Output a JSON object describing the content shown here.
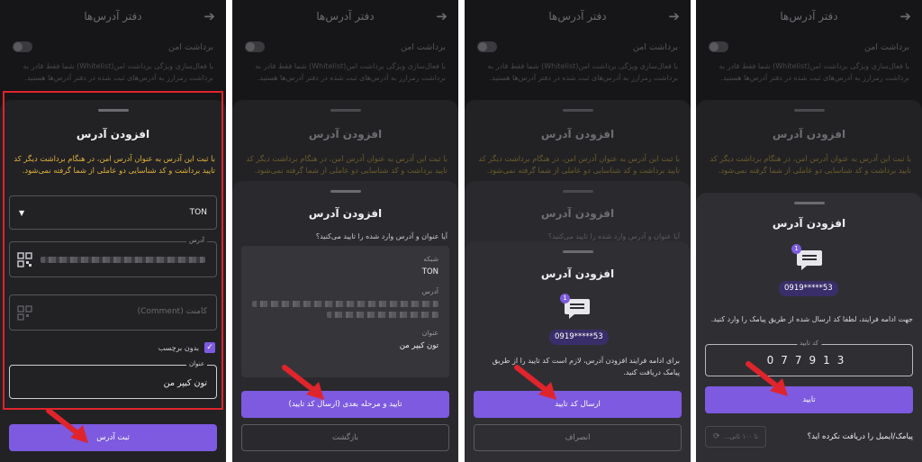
{
  "header": {
    "title": "دفتر آدرس‌ها",
    "back_icon": "arrow-right-icon"
  },
  "safe_withdraw": {
    "label": "برداشت امن",
    "description": "با فعال‌سازی ویژگی برداشت امن(Whitelist) شما فقط قادر به برداشت رمزارز به آدرس‌های ثبت شده در دفتر آدرس‌ها هستید."
  },
  "add_address": {
    "title": "افزودن آدرس",
    "warning": "با ثبت این آدرس به عنوان آدرس امن، در هنگام برداشت دیگر کد تایید برداشت و کد شناسایی دو عاملی از شما گرفته نمی‌شود.",
    "network_value": "TON",
    "address_label": "آدرس",
    "comment_placeholder": "کامنت (Comment)",
    "no_tag_label": "بدون برچسب",
    "title_label": "عنوان",
    "title_value": "تون کیپر من",
    "submit_label": "ثبت آدرس"
  },
  "confirm": {
    "title": "افزودن آدرس",
    "question": "آیا عنوان و آدرس وارد شده را تایید می‌کنید؟",
    "network_key": "شبکه",
    "network_value": "TON",
    "address_key": "آدرس",
    "title_key": "عنوان",
    "title_value": "تون کیپر من",
    "confirm_label": "تایید و مرحله بعدی (ارسال کد تایید)",
    "back_label": "بازگشت"
  },
  "send_code": {
    "title": "افزودن آدرس",
    "badge": "1",
    "phone": "0919*****53",
    "text": "برای ادامه فرایند افزودن آدرس، لازم است کد تایید را از طریق پیامک دریافت کنید.",
    "send_label": "ارسال کد تایید",
    "cancel_label": "انصراف"
  },
  "verify": {
    "title": "افزودن آدرس",
    "badge": "1",
    "phone": "0919*****53",
    "text": "جهت ادامه فرایند، لطفا کد ارسال شده از طریق پیامک را وارد کنید.",
    "code_label": "کد تایید",
    "code_value": "077913",
    "confirm_label": "تایید",
    "not_received": "پیامک/ایمیل را دریافت نکرده اید؟",
    "resend_label": "تا ۱۰۰ ثانی..."
  }
}
